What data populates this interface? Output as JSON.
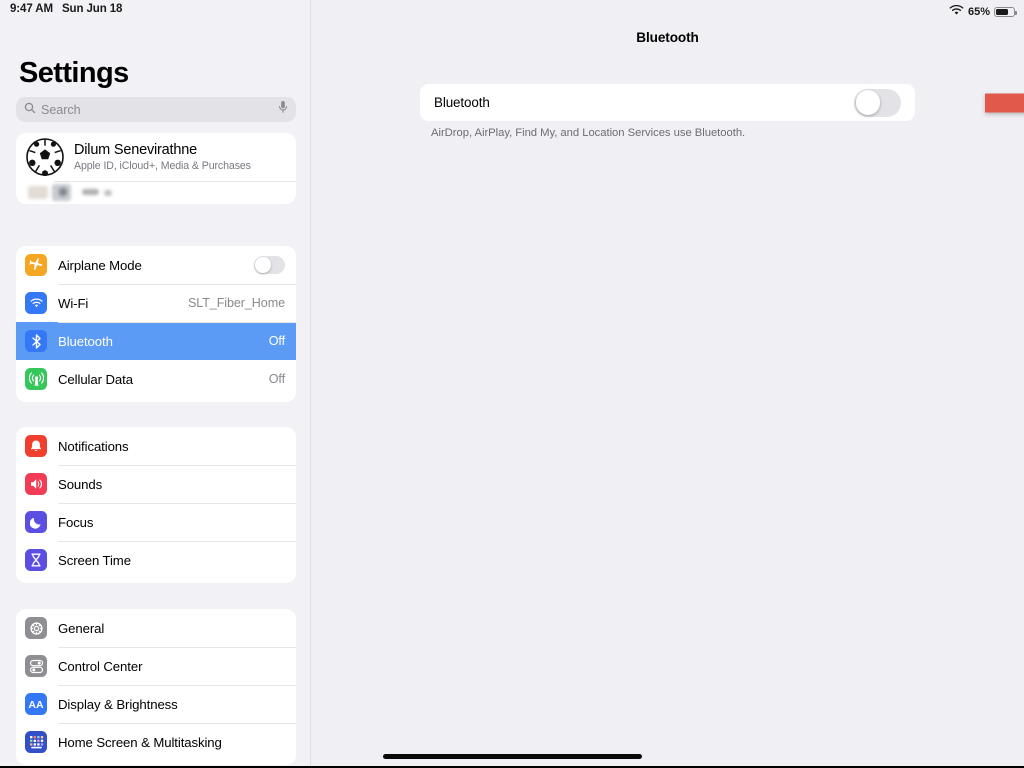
{
  "status_bar": {
    "time": "9:47 AM",
    "date": "Sun Jun 18",
    "wifi_icon": "wifi-icon",
    "battery_percent": "65%",
    "battery_icon": "battery-icon",
    "battery_level": 0.65
  },
  "sidebar": {
    "title": "Settings",
    "search": {
      "placeholder": "Search",
      "value": "",
      "search_icon": "search-icon",
      "mic_icon": "microphone-icon"
    },
    "profile": {
      "name": "Dilum Senevirathne",
      "subtitle": "Apple ID, iCloud+, Media & Purchases",
      "avatar_icon": "soccer-ball-avatar",
      "redacted_row": ""
    },
    "groups": [
      {
        "name": "connectivity",
        "items": [
          {
            "label": "Airplane Mode",
            "icon": "airplane-icon",
            "icon_color": "#F5A623",
            "control": "toggle",
            "toggle_on": false,
            "value": ""
          },
          {
            "label": "Wi-Fi",
            "icon": "wifi-icon",
            "icon_color": "#3478F6",
            "control": "value",
            "value": "SLT_Fiber_Home"
          },
          {
            "label": "Bluetooth",
            "icon": "bluetooth-icon",
            "icon_color": "#3478F6",
            "control": "value",
            "value": "Off",
            "selected": true
          },
          {
            "label": "Cellular Data",
            "icon": "cellular-icon",
            "icon_color": "#35C759",
            "control": "value",
            "value": "Off"
          }
        ]
      },
      {
        "name": "alerts",
        "items": [
          {
            "label": "Notifications",
            "icon": "notifications-bell-icon",
            "icon_color": "#F03E2F",
            "control": "none",
            "value": ""
          },
          {
            "label": "Sounds",
            "icon": "speaker-sounds-icon",
            "icon_color": "#F23B54",
            "control": "none",
            "value": ""
          },
          {
            "label": "Focus",
            "icon": "moon-focus-icon",
            "icon_color": "#5A4FE0",
            "control": "none",
            "value": ""
          },
          {
            "label": "Screen Time",
            "icon": "hourglass-screen-time-icon",
            "icon_color": "#5A4FE0",
            "control": "none",
            "value": ""
          }
        ]
      },
      {
        "name": "system",
        "items": [
          {
            "label": "General",
            "icon": "gear-icon",
            "icon_color": "#8E8E93",
            "control": "none",
            "value": ""
          },
          {
            "label": "Control Center",
            "icon": "control-center-icon",
            "icon_color": "#8E8E93",
            "control": "none",
            "value": ""
          },
          {
            "label": "Display & Brightness",
            "icon": "display-brightness-aa-icon",
            "icon_color": "#3478F6",
            "control": "none",
            "value": ""
          },
          {
            "label": "Home Screen & Multitasking",
            "icon": "home-screen-grid-icon",
            "icon_color": "#3250C8",
            "control": "none",
            "value": ""
          }
        ]
      }
    ]
  },
  "detail": {
    "title": "Bluetooth",
    "toggle_row": {
      "label": "Bluetooth",
      "toggle_on": false,
      "toggle_name": "bluetooth-toggle"
    },
    "footnote": "AirDrop, AirPlay, Find My, and Location Services use Bluetooth.",
    "annotation": {
      "type": "red-arrow",
      "color": "#E0594B",
      "points_to": "bluetooth-toggle"
    }
  },
  "home_indicator": "home-indicator",
  "colors": {
    "accent_blue": "#5B9BF5",
    "background": "#F0F0F4",
    "sidebar_background": "#F2F1F5",
    "card_background": "#FFFFFF",
    "annotation_red": "#E0594B",
    "secondary_text": "#8A8A8F"
  }
}
